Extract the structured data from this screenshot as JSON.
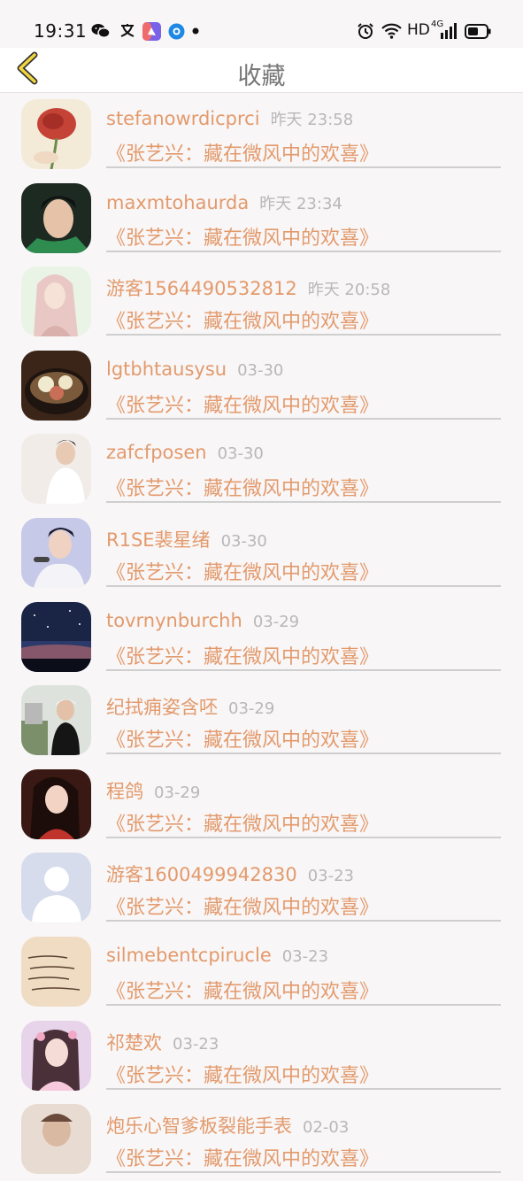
{
  "status_bar": {
    "time": "19:31",
    "hd_label": "HD",
    "network_label": "4G",
    "left_icons": [
      "wechat-icon",
      "translate-icon",
      "app-icon",
      "browser-icon",
      "dot-icon"
    ],
    "right_icons": [
      "alarm-icon",
      "wifi-icon",
      "signal-icon",
      "battery-icon"
    ]
  },
  "header": {
    "title": "收藏",
    "back_icon": "chevron-left-icon",
    "accent_color": "#e39a6c"
  },
  "items": [
    {
      "name": "stefanowrdicprci",
      "time": "昨天 23:58",
      "title": "《张艺兴：藏在微风中的欢喜》",
      "avatar": "rose"
    },
    {
      "name": "maxmtohaurda",
      "time": "昨天 23:34",
      "title": "《张艺兴：藏在微风中的欢喜》",
      "avatar": "man-green"
    },
    {
      "name": "游客1564490532812",
      "time": "昨天 20:58",
      "title": "《张艺兴：藏在微风中的欢喜》",
      "avatar": "anime-girl"
    },
    {
      "name": "lgtbhtausysu",
      "time": "03-30",
      "title": "《张艺兴：藏在微风中的欢喜》",
      "avatar": "food-bowl"
    },
    {
      "name": "zafcfposen",
      "time": "03-30",
      "title": "《张艺兴：藏在微风中的欢喜》",
      "avatar": "boy-white"
    },
    {
      "name": "R1SE裴星绪",
      "time": "03-30",
      "title": "《张艺兴：藏在微风中的欢喜》",
      "avatar": "singer"
    },
    {
      "name": "tovrnynburchh",
      "time": "03-29",
      "title": "《张艺兴：藏在微风中的欢喜》",
      "avatar": "night-sky"
    },
    {
      "name": "纪拭痈姿含呸",
      "time": "03-29",
      "title": "《张艺兴：藏在微风中的欢喜》",
      "avatar": "street-man"
    },
    {
      "name": "程鸽",
      "time": "03-29",
      "title": "《张艺兴：藏在微风中的欢喜》",
      "avatar": "woman-red"
    },
    {
      "name": "游客1600499942830",
      "time": "03-23",
      "title": "《张艺兴：藏在微风中的欢喜》",
      "avatar": "default-user"
    },
    {
      "name": "silmebentcpirucle",
      "time": "03-23",
      "title": "《张艺兴：藏在微风中的欢喜》",
      "avatar": "handwriting"
    },
    {
      "name": "祁楚欢",
      "time": "03-23",
      "title": "《张艺兴：藏在微风中的欢喜》",
      "avatar": "girl-pink"
    },
    {
      "name": "炮乐心智爹板裂能手表",
      "time": "02-03",
      "title": "《张艺兴：藏在微风中的欢喜》",
      "avatar": "partial"
    }
  ]
}
